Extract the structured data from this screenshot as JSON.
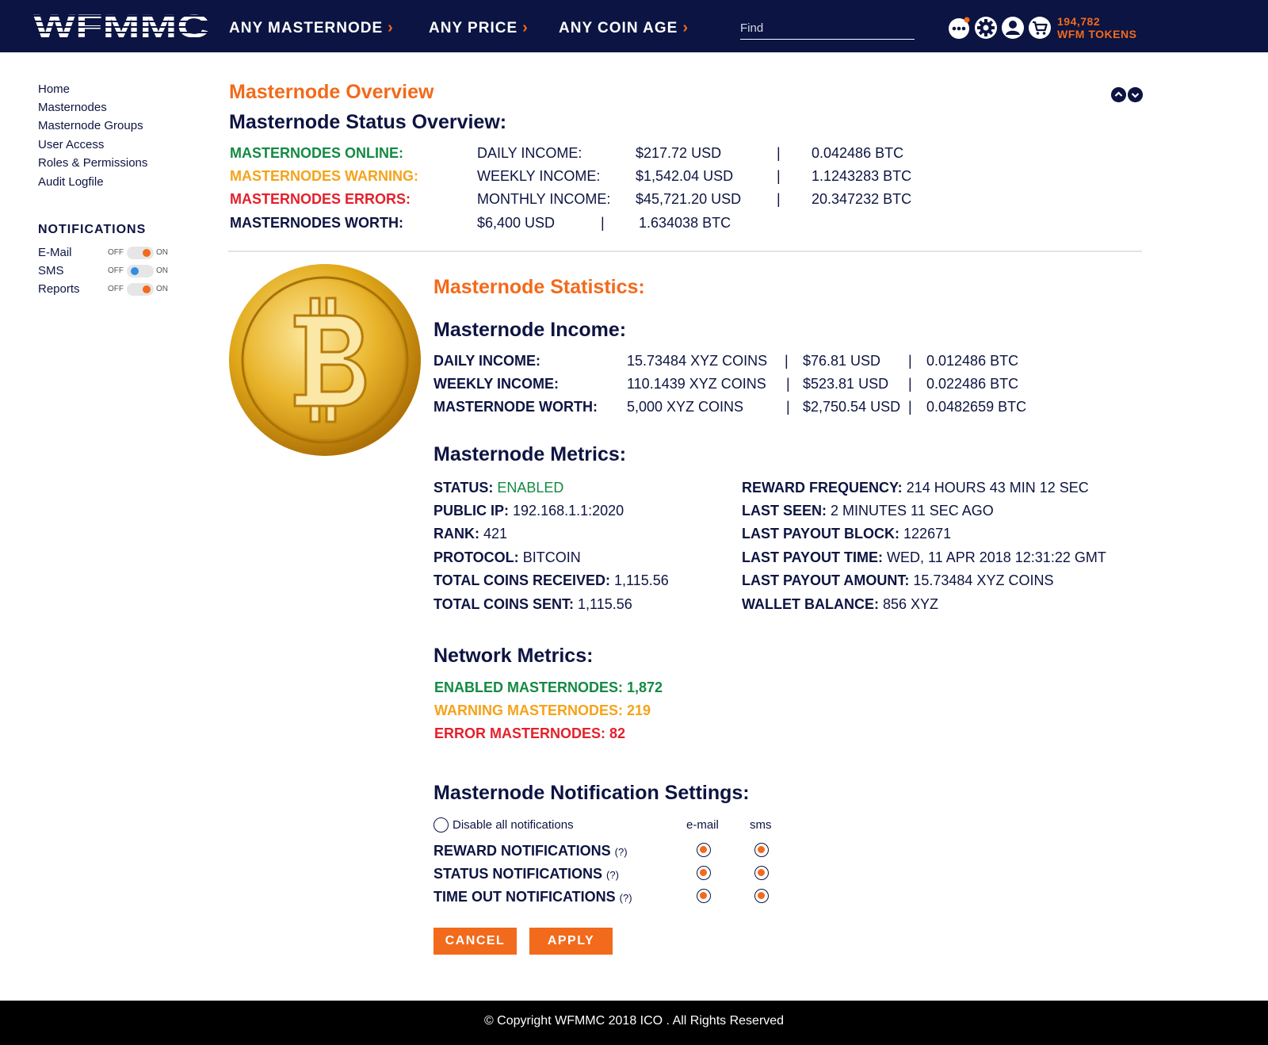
{
  "header": {
    "logo_text": "WFMMC",
    "nav": [
      {
        "label": "ANY MASTERNODE"
      },
      {
        "label": "ANY PRICE"
      },
      {
        "label": "ANY COIN AGE"
      }
    ],
    "search_placeholder": "Find",
    "tokens_amount": "194,782",
    "tokens_label": "WFM TOKENS",
    "accent_color": "#f26a1b",
    "bar_color": "#0b1442"
  },
  "sidebar": {
    "links": [
      "Home",
      "Masternodes",
      "Masternode Groups",
      "User Access",
      "Roles & Permissions",
      "Audit Logfile"
    ],
    "notifications_title": "NOTIFICATIONS",
    "off_label": "OFF",
    "on_label": "ON",
    "notifications": [
      {
        "label": "E-Mail",
        "state": "on"
      },
      {
        "label": "SMS",
        "state": "off"
      },
      {
        "label": "Reports",
        "state": "on"
      }
    ]
  },
  "overview": {
    "title": "Masternode Overview",
    "status_title": "Masternode Status Overview:",
    "online_label": "MASTERNODES ONLINE:",
    "warning_label": "MASTERNODES WARNING:",
    "errors_label": "MASTERNODES ERRORS:",
    "worth_label": "MASTERNODES WORTH:",
    "daily_label": "DAILY INCOME:",
    "weekly_label": "WEEKLY INCOME:",
    "monthly_label": "MONTHLY INCOME:",
    "daily_usd": "$217.72 USD",
    "daily_btc": "0.042486 BTC",
    "weekly_usd": "$1,542.04 USD",
    "weekly_btc": "1.1243283 BTC",
    "monthly_usd": "$45,721.20 USD",
    "monthly_btc": "20.347232 BTC",
    "worth_usd": "$6,400 USD",
    "worth_btc": "1.634038 BTC",
    "separator": "|"
  },
  "statistics": {
    "title": "Masternode Statistics:",
    "income_title": "Masternode Income:",
    "income_rows": [
      {
        "label": "DAILY INCOME:",
        "coins": "15.73484 XYZ COINS",
        "usd": "$76.81 USD",
        "btc": "0.012486 BTC"
      },
      {
        "label": "WEEKLY INCOME:",
        "coins": "110.1439 XYZ COINS",
        "usd": "$523.81 USD",
        "btc": "0.022486 BTC"
      },
      {
        "label": "MASTERNODE WORTH:",
        "coins": "5,000 XYZ COINS",
        "usd": "$2,750.54 USD",
        "btc": "0.0482659 BTC"
      }
    ],
    "metrics_title": "Masternode Metrics:",
    "metrics_left": [
      {
        "label": "STATUS:",
        "value": "ENABLED"
      },
      {
        "label": "PUBLIC IP:",
        "value": "192.168.1.1:2020"
      },
      {
        "label": "RANK:",
        "value": "421"
      },
      {
        "label": "PROTOCOL:",
        "value": "BITCOIN"
      },
      {
        "label": "TOTAL COINS RECEIVED:",
        "value": "1,115.56"
      },
      {
        "label": "TOTAL COINS SENT:",
        "value": "1,115.56"
      }
    ],
    "metrics_right": [
      {
        "label": "REWARD FREQUENCY:",
        "value": "214 HOURS 43 MIN 12 SEC"
      },
      {
        "label": "LAST SEEN:",
        "value": "2 MINUTES 11 SEC AGO"
      },
      {
        "label": "LAST PAYOUT BLOCK:",
        "value": "122671"
      },
      {
        "label": "LAST PAYOUT TIME:",
        "value": "WED, 11 APR 2018 12:31:22 GMT"
      },
      {
        "label": "LAST PAYOUT AMOUNT:",
        "value": "15.73484 XYZ COINS"
      },
      {
        "label": "WALLET BALANCE:",
        "value": "856 XYZ"
      }
    ],
    "network_title": "Network Metrics:",
    "enabled_text": "ENABLED MASTERNODES: 1,872",
    "warning_text": "WARNING MASTERNODES: 219",
    "error_text": "ERROR MASTERNODES: 82"
  },
  "notification_settings": {
    "title": "Masternode Notification Settings:",
    "disable_all": "Disable all notifications",
    "col_email": "e-mail",
    "col_sms": "sms",
    "help": "(?)",
    "rows": [
      {
        "label": "REWARD NOTIFICATIONS"
      },
      {
        "label": "STATUS NOTIFICATIONS"
      },
      {
        "label": "TIME OUT NOTIFICATIONS"
      }
    ],
    "cancel_label": "CANCEL",
    "apply_label": "APPLY"
  },
  "footer": {
    "copyright": "© Copyright WFMMC 2018 ICO . All Rights Reserved"
  }
}
